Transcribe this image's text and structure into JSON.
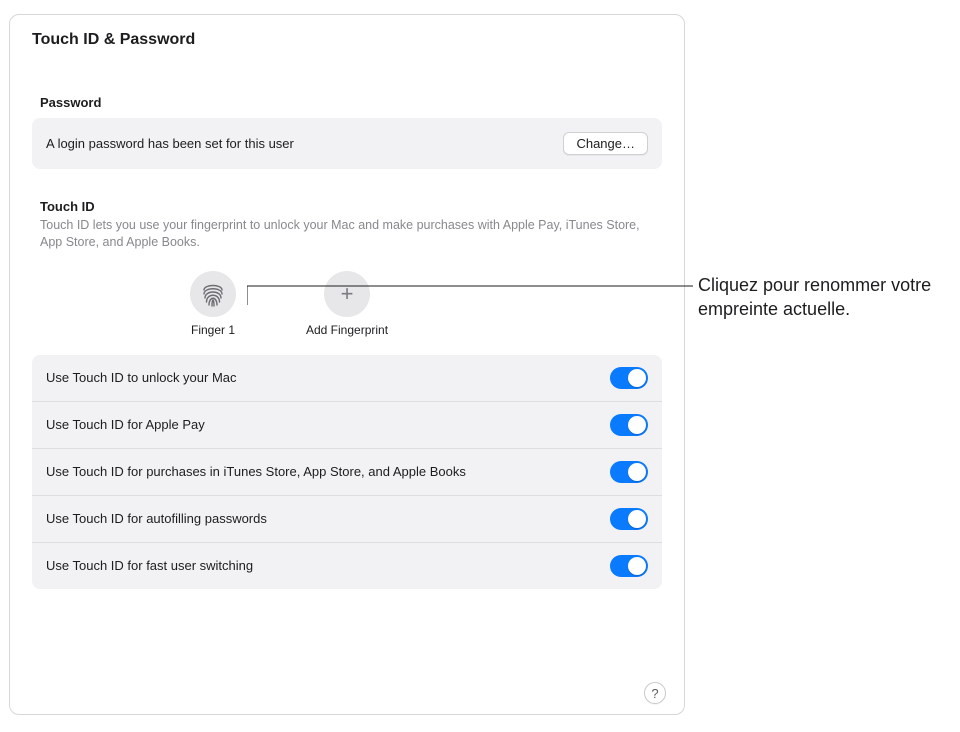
{
  "header": {
    "title": "Touch ID & Password"
  },
  "password_section": {
    "label": "Password",
    "desc": "A login password has been set for this user",
    "change_label": "Change…"
  },
  "touchid": {
    "title": "Touch ID",
    "subtitle": "Touch ID lets you use your fingerprint to unlock your Mac and make purchases with Apple Pay, iTunes Store, App Store, and Apple Books.",
    "fingers": [
      {
        "label": "Finger 1",
        "icon": "fingerprint-icon"
      }
    ],
    "add_label": "Add Fingerprint",
    "options": [
      {
        "label": "Use Touch ID to unlock your Mac",
        "on": true
      },
      {
        "label": "Use Touch ID for Apple Pay",
        "on": true
      },
      {
        "label": "Use Touch ID for purchases in iTunes Store, App Store, and Apple Books",
        "on": true
      },
      {
        "label": "Use Touch ID for autofilling passwords",
        "on": true
      },
      {
        "label": "Use Touch ID for fast user switching",
        "on": true
      }
    ]
  },
  "help": {
    "glyph": "?"
  },
  "callout": {
    "text": "Cliquez pour renommer votre empreinte actuelle."
  }
}
